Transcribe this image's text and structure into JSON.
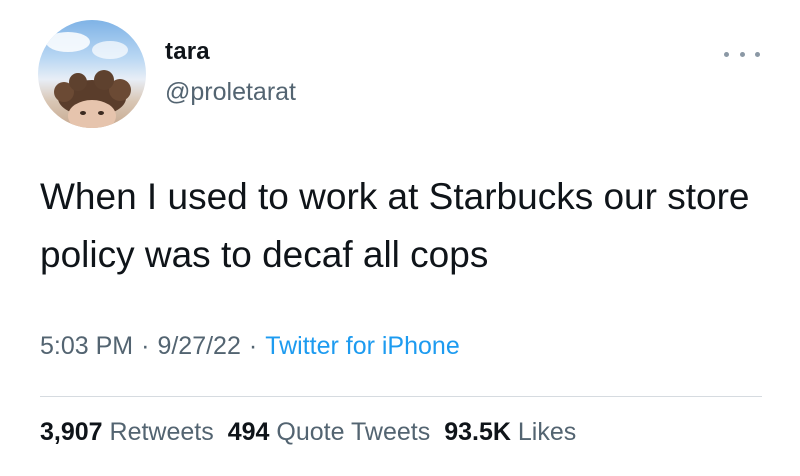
{
  "author": {
    "display_name": "tara",
    "handle": "@proletarat"
  },
  "tweet": {
    "text": "When I used to work at Starbucks our store policy was to decaf all cops"
  },
  "meta": {
    "time": "5:03 PM",
    "date": "9/27/22",
    "separator": "·",
    "source": "Twitter for iPhone"
  },
  "stats": {
    "retweets_count": "3,907",
    "retweets_label": "Retweets",
    "quotes_count": "494",
    "quotes_label": "Quote Tweets",
    "likes_count": "93.5K",
    "likes_label": "Likes"
  },
  "icons": {
    "more": "more-horizontal-icon",
    "avatar": "avatar-photo"
  },
  "colors": {
    "text": "#0f1419",
    "secondary": "#536471",
    "link": "#1d9bf0"
  }
}
